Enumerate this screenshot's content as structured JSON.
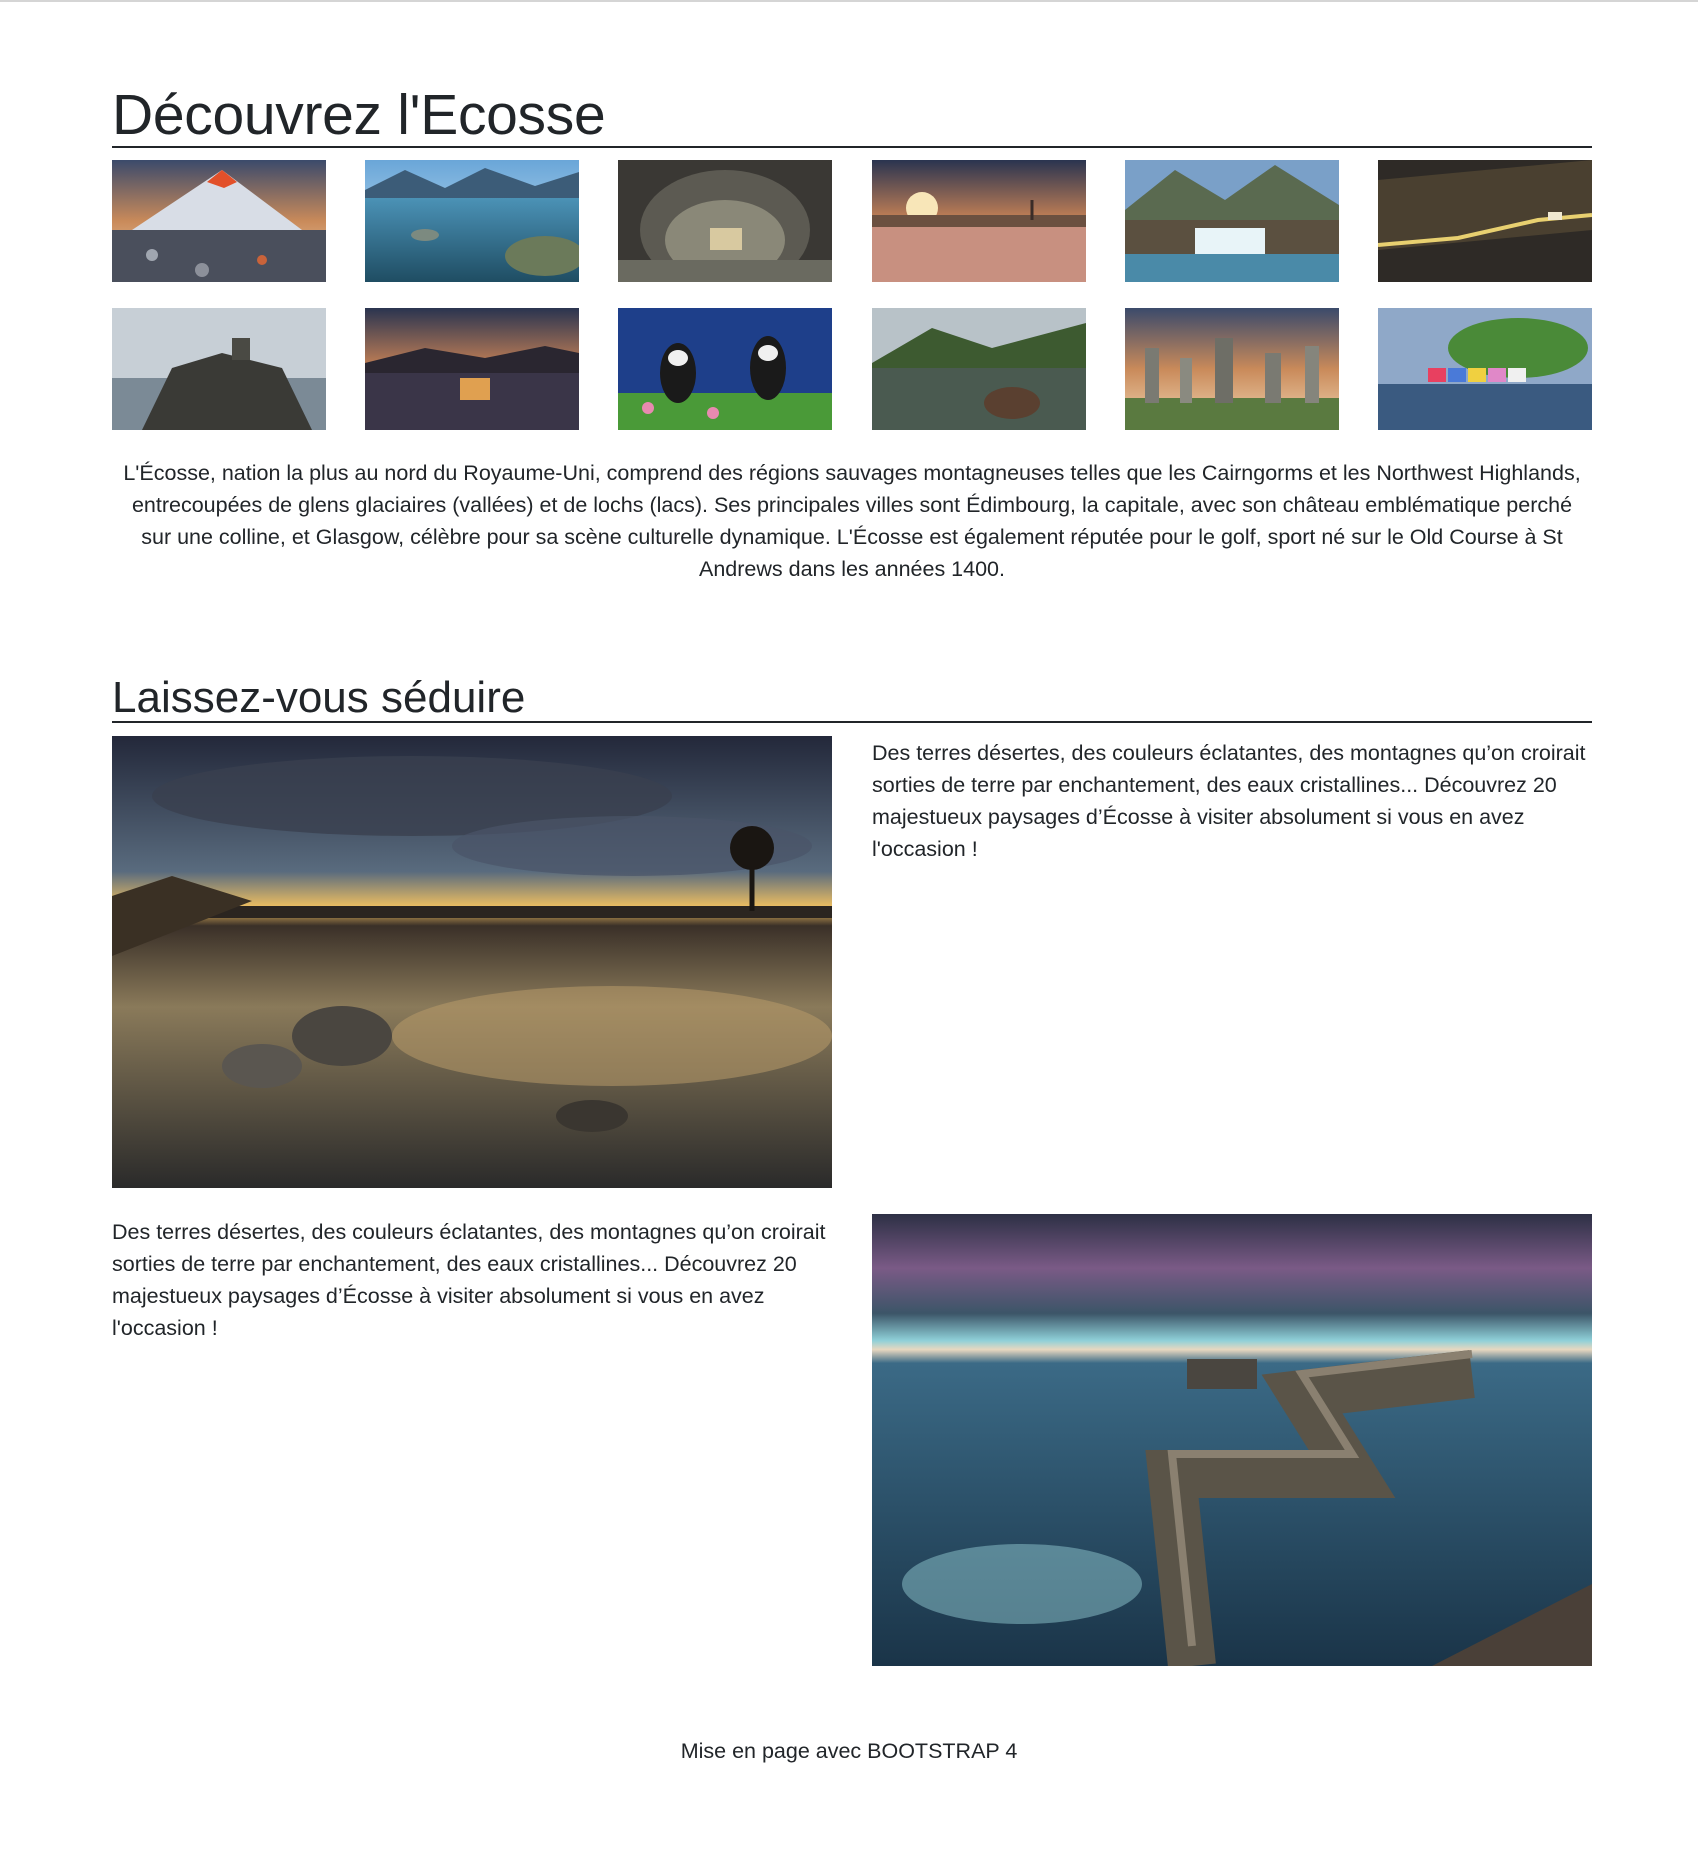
{
  "section1": {
    "title": "Découvrez l'Ecosse",
    "thumbnails": [
      {
        "name": "volcano-mountain"
      },
      {
        "name": "blue-loch"
      },
      {
        "name": "cave"
      },
      {
        "name": "misty-sunrise-loch"
      },
      {
        "name": "waterfall"
      },
      {
        "name": "dark-hill-road"
      },
      {
        "name": "cliff-castle-ruin"
      },
      {
        "name": "illuminated-castle-dusk"
      },
      {
        "name": "puffins"
      },
      {
        "name": "loch-reflection-rocks"
      },
      {
        "name": "standing-stones"
      },
      {
        "name": "colorful-harbour-village"
      }
    ],
    "intro": "L'Écosse, nation la plus au nord du Royaume-Uni, comprend des régions sauvages montagneuses telles que les Cairngorms et les Northwest Highlands, entrecoupées de glens glaciaires (vallées) et de lochs (lacs). Ses principales villes sont Édimbourg, la capitale, avec son château emblématique perché sur une colline, et Glasgow, célèbre pour sa scène culturelle dynamique. L'Écosse est également réputée pour le golf, sport né sur le Old Course à St Andrews dans les années 1400."
  },
  "section2": {
    "title": "Laissez-vous séduire",
    "block1_text": "Des terres désertes, des couleurs éclatantes, des montagnes qu’on croirait sorties de terre par enchantement, des eaux cristallines... Découvrez 20 majestueux paysages d’Écosse à visiter absolument si vous en avez l'occasion !",
    "block2_text": "Des terres désertes, des couleurs éclatantes, des montagnes qu’on croirait sorties de terre par enchantement, des eaux cristallines... Découvrez 20 majestueux paysages d’Écosse à visiter absolument si vous en avez l'occasion !"
  },
  "footer": {
    "text": "Mise en page avec BOOTSTRAP 4"
  }
}
